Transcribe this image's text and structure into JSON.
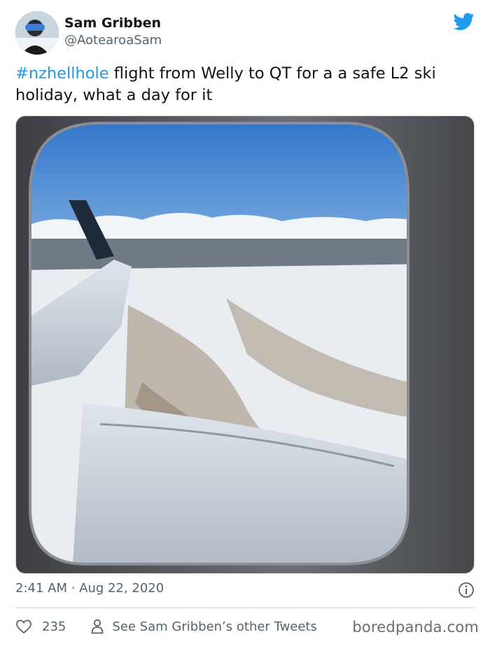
{
  "author": {
    "name": "Sam Gribben",
    "handle": "@AotearoaSam"
  },
  "tweet": {
    "hashtag": "#nzhellhole",
    "text": " flight from Welly to QT for a a safe L2 ski holiday, what a day for it"
  },
  "meta": {
    "timestamp": "2:41 AM · Aug 22, 2020"
  },
  "footer": {
    "likes": "235",
    "other_tweets_link": "See Sam Gribben’s other Tweets"
  },
  "watermark": "boredpanda.com",
  "colors": {
    "accent": "#1d9bf0",
    "secondary_text": "#536471",
    "border": "#cfd9de"
  },
  "icons": [
    "twitter-bird-icon",
    "info-icon",
    "heart-icon",
    "person-icon"
  ]
}
